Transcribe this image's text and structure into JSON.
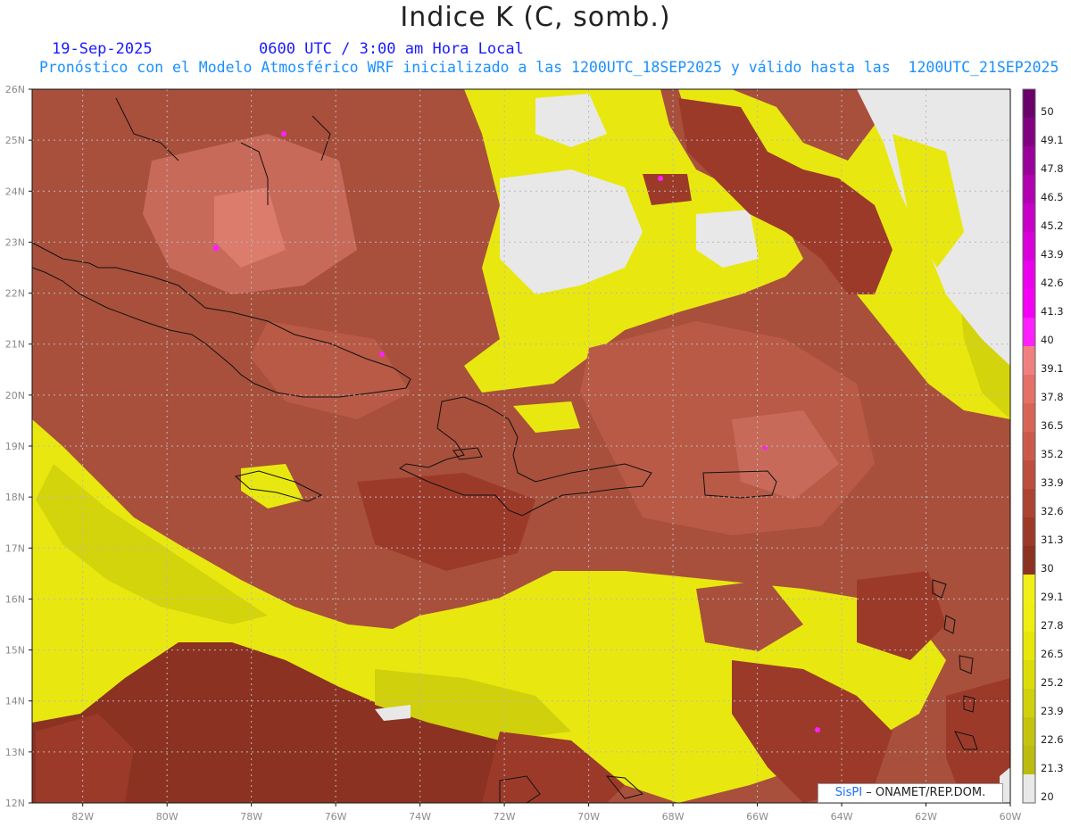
{
  "header": {
    "title": "Indice K (C, somb.)",
    "date": "19-Sep-2025",
    "time": "0600 UTC / 3:00 am Hora Local",
    "forecast": "Pronóstico con el Modelo Atmosférico WRF inicializado a las 1200UTC_18SEP2025 y válido hasta las  1200UTC_21SEP2025"
  },
  "axes": {
    "lon_labels": [
      "82W",
      "80W",
      "78W",
      "76W",
      "74W",
      "72W",
      "70W",
      "68W",
      "66W",
      "64W",
      "62W",
      "60W"
    ],
    "lat_labels": [
      "26N",
      "25N",
      "24N",
      "23N",
      "22N",
      "21N",
      "20N",
      "19N",
      "18N",
      "17N",
      "16N",
      "15N",
      "14N",
      "13N",
      "12N"
    ],
    "lon_range": [
      -83.2,
      -60
    ],
    "lat_range": [
      12,
      26
    ]
  },
  "colorbar": {
    "labels": [
      "50",
      "49.1",
      "47.8",
      "46.5",
      "45.2",
      "43.9",
      "42.6",
      "41.3",
      "40",
      "39.1",
      "37.8",
      "36.5",
      "35.2",
      "33.9",
      "32.6",
      "31.3",
      "30",
      "29.1",
      "27.8",
      "26.5",
      "25.2",
      "23.9",
      "22.6",
      "21.3",
      "20"
    ],
    "colors": [
      "#6a006a",
      "#800080",
      "#9a009a",
      "#b000b0",
      "#c600c6",
      "#d800d8",
      "#ea00ea",
      "#f400f4",
      "#ff20ff",
      "#f08080",
      "#e47068",
      "#d86458",
      "#cc5a4c",
      "#bc4e40",
      "#ac4434",
      "#9c3a2a",
      "#8b3222",
      "#f0f018",
      "#eeee10",
      "#e6e608",
      "#dcdc0a",
      "#d0d00c",
      "#c4c40e",
      "#bbbb10",
      "#e8e8e8"
    ]
  },
  "credit": {
    "brand": "SisPI",
    "org": "ONAMET/REP.DOM."
  }
}
